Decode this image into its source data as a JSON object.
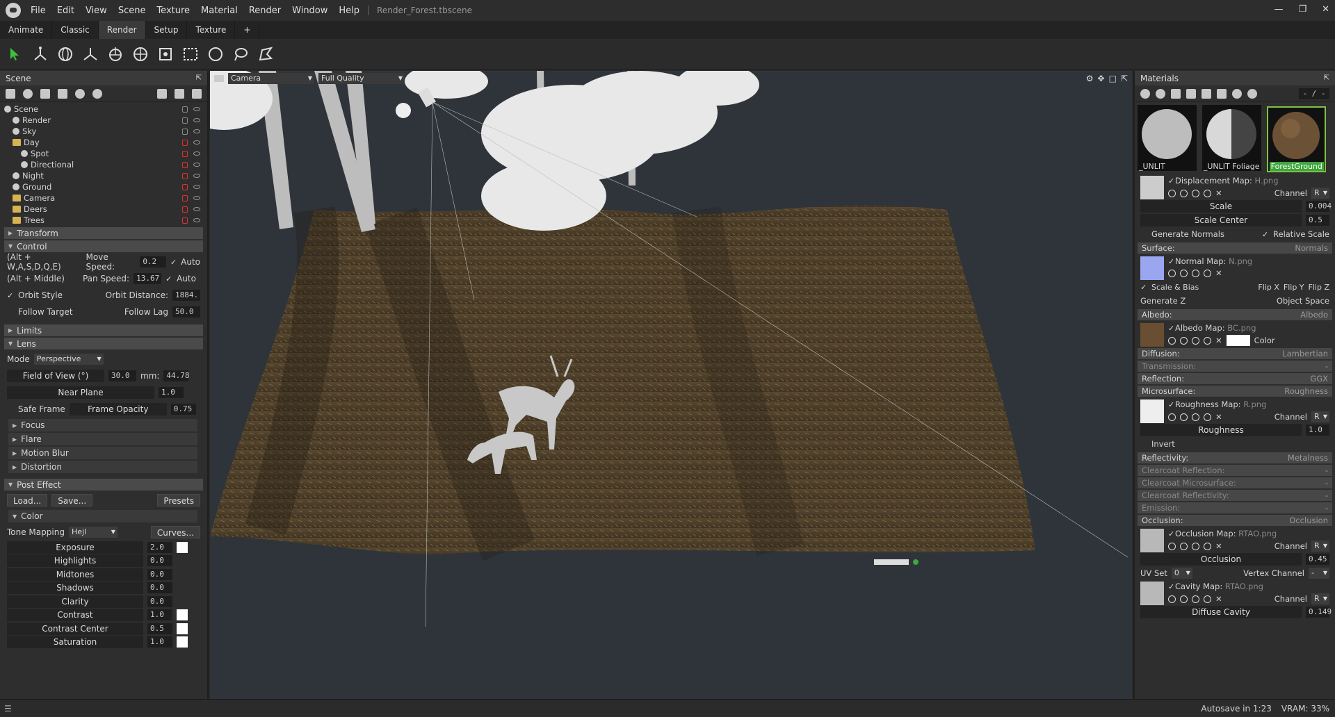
{
  "menu": [
    "File",
    "Edit",
    "View",
    "Scene",
    "Texture",
    "Material",
    "Render",
    "Window",
    "Help"
  ],
  "doc_title": "Render_Forest.tbscene",
  "layout_tabs": [
    "Animate",
    "Classic",
    "Render",
    "Setup",
    "Texture",
    "+"
  ],
  "active_layout_tab": "Render",
  "scene": {
    "panel_title": "Scene",
    "tree": [
      {
        "label": "Scene",
        "depth": 0,
        "icon": "scene-icon",
        "lock": "grey"
      },
      {
        "label": "Render",
        "depth": 1,
        "icon": "render-icon",
        "lock": "grey"
      },
      {
        "label": "Sky",
        "depth": 1,
        "icon": "sky-icon",
        "lock": "grey"
      },
      {
        "label": "Day",
        "depth": 1,
        "icon": "folder-icon",
        "lock": "red"
      },
      {
        "label": "Spot",
        "depth": 2,
        "icon": "spot-light-icon",
        "lock": "red"
      },
      {
        "label": "Directional",
        "depth": 2,
        "icon": "directional-light-icon",
        "lock": "red"
      },
      {
        "label": "Night",
        "depth": 1,
        "icon": "night-icon",
        "lock": "red"
      },
      {
        "label": "Ground",
        "depth": 1,
        "icon": "mesh-icon",
        "lock": "red"
      },
      {
        "label": "Camera",
        "depth": 1,
        "icon": "folder-icon",
        "lock": "red"
      },
      {
        "label": "Deers",
        "depth": 1,
        "icon": "folder-icon",
        "lock": "red"
      },
      {
        "label": "Trees",
        "depth": 1,
        "icon": "folder-icon",
        "lock": "red"
      }
    ]
  },
  "props": {
    "transform": "Transform",
    "control": "Control",
    "move_hint": "(Alt + W,A,S,D,Q,E)",
    "move_speed_label": "Move Speed:",
    "move_speed": "0.2",
    "auto_label": "Auto",
    "pan_hint": "(Alt + Middle)",
    "pan_speed_label": "Pan Speed:",
    "pan_speed": "13.67",
    "orbit_style": "Orbit Style",
    "orbit_distance_label": "Orbit Distance:",
    "orbit_distance": "1884.",
    "follow_target": "Follow Target",
    "follow_lag_label": "Follow Lag",
    "follow_lag": "50.0",
    "limits": "Limits",
    "lens": "Lens",
    "mode_label": "Mode",
    "mode": "Perspective",
    "fov_label": "Field of View (°)",
    "fov": "30.0",
    "mm_label": "mm:",
    "mm": "44.78",
    "near_plane_label": "Near Plane",
    "near_plane": "1.0",
    "safe_frame": "Safe Frame",
    "frame_opacity_label": "Frame Opacity",
    "frame_opacity": "0.75",
    "focus": "Focus",
    "flare": "Flare",
    "motion_blur": "Motion Blur",
    "distortion": "Distortion",
    "post_effect": "Post Effect",
    "load": "Load...",
    "save": "Save...",
    "presets": "Presets",
    "color": "Color",
    "tone_mapping_label": "Tone Mapping",
    "tone_mapping": "Hejl",
    "curves": "Curves...",
    "sliders": [
      {
        "label": "Exposure",
        "value": "2.0",
        "swatch": true
      },
      {
        "label": "Highlights",
        "value": "0.0",
        "swatch": false
      },
      {
        "label": "Midtones",
        "value": "0.0",
        "swatch": false
      },
      {
        "label": "Shadows",
        "value": "0.0",
        "swatch": false
      },
      {
        "label": "Clarity",
        "value": "0.0",
        "swatch": false
      },
      {
        "label": "Contrast",
        "value": "1.0",
        "swatch": true
      },
      {
        "label": "Contrast Center",
        "value": "0.5",
        "swatch": true
      },
      {
        "label": "Saturation",
        "value": "1.0",
        "swatch": true
      }
    ]
  },
  "viewport": {
    "camera": "Camera",
    "quality": "Full Quality"
  },
  "materials": {
    "panel_title": "Materials",
    "counter": "- / -",
    "thumbs": [
      {
        "label": "_UNLIT"
      },
      {
        "label": "_UNLIT Foliage"
      },
      {
        "label": "ForestGround"
      }
    ],
    "displacement_map": "Displacement Map:",
    "displacement_file": "H.png",
    "channel_label": "Channel",
    "channel": "R",
    "scale_label": "Scale",
    "scale": "0.004",
    "scale_center_label": "Scale Center",
    "scale_center": "0.5",
    "generate_normals": "Generate Normals",
    "relative_scale": "Relative Scale",
    "surface": "Surface:",
    "surface_type": "Normals",
    "normal_map": "Normal Map:",
    "normal_file": "N.png",
    "scale_bias": "Scale & Bias",
    "flip_x": "Flip X",
    "flip_y": "Flip Y",
    "flip_z": "Flip Z",
    "generate_z": "Generate Z",
    "object_space": "Object Space",
    "albedo": "Albedo:",
    "albedo_type": "Albedo",
    "albedo_map": "Albedo Map:",
    "albedo_file": "BC.png",
    "color_label": "Color",
    "diffusion": "Diffusion:",
    "diffusion_type": "Lambertian",
    "transmission": "Transmission:",
    "transmission_type": "-",
    "reflection": "Reflection:",
    "reflection_type": "GGX",
    "microsurface": "Microsurface:",
    "microsurface_type": "Roughness",
    "roughness_map": "Roughness Map:",
    "roughness_file": "R.png",
    "roughness_label": "Roughness",
    "roughness": "1.0",
    "invert": "Invert",
    "reflectivity": "Reflectivity:",
    "reflectivity_type": "Metalness",
    "clearcoat_reflection": "Clearcoat Reflection:",
    "clearcoat_microsurface": "Clearcoat Microsurface:",
    "clearcoat_reflectivity": "Clearcoat Reflectivity:",
    "emission": "Emission:",
    "dash": "-",
    "occlusion": "Occlusion:",
    "occlusion_type": "Occlusion",
    "occlusion_map": "Occlusion Map:",
    "occlusion_file": "RTAO.png",
    "occlusion_label": "Occlusion",
    "occlusion_val": "0.45",
    "uv_set_label": "UV Set",
    "uv_set": "0",
    "vertex_channel_label": "Vertex Channel",
    "vertex_channel": "-",
    "cavity_map": "Cavity Map:",
    "cavity_file": "RTAO.png",
    "diffuse_cavity_label": "Diffuse Cavity",
    "diffuse_cavity": "0.149"
  },
  "status": {
    "autosave": "Autosave in 1:23",
    "vram": "VRAM: 33%"
  },
  "colors": {
    "accent": "#3fa63f",
    "lock_red": "#d33",
    "folder": "#d8b451",
    "ground": "#4a3b28"
  }
}
